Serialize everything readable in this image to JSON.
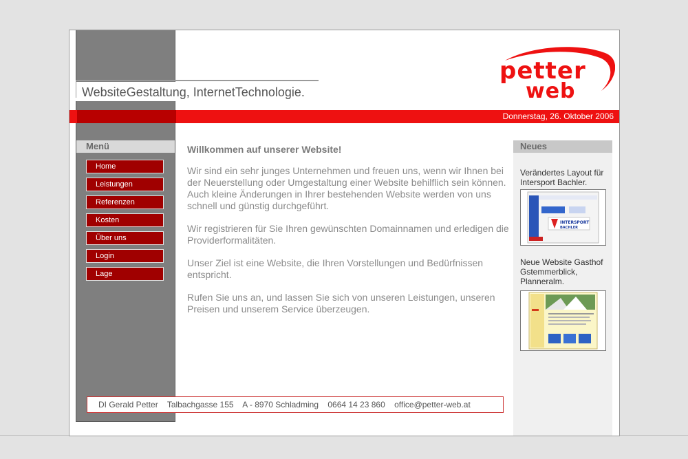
{
  "header": {
    "tagline": "WebsiteGestaltung, InternetTechnologie.",
    "logo_line1": "petter",
    "logo_line2": "web",
    "date": "Donnerstag, 26. Oktober 2006"
  },
  "menu": {
    "title": "Menü",
    "items": [
      "Home",
      "Leistungen",
      "Referenzen",
      "Kosten",
      "Über uns",
      "Login",
      "Lage"
    ]
  },
  "content": {
    "heading": "Willkommen auf unserer Website!",
    "paragraphs": [
      "Wir sind ein sehr junges Unternehmen und freuen uns, wenn wir Ihnen bei der Neuerstellung oder Umgestaltung einer Website behilflich sein können. Auch kleine Änderungen in Ihrer bestehenden Website werden von uns schnell und günstig durchgeführt.",
      "Wir registrieren für Sie Ihren gewünschten Domainnamen und erledigen die Providerformalitäten.",
      "Unser Ziel ist eine Website, die Ihren Vorstellungen und Bedürfnissen entspricht.",
      "Rufen Sie uns an, und lassen Sie sich von unseren Leistungen, unseren Preisen und unserem Service überzeugen."
    ]
  },
  "news": {
    "title": "Neues",
    "items": [
      {
        "text": "Verändertes Layout für Intersport Bachler.",
        "thumb_brand": "INTERSPORT",
        "thumb_sub": "BACHLER"
      },
      {
        "text": "Neue Website Gasthof Gstemmerblick, Planneralm."
      }
    ]
  },
  "footer": {
    "name": "DI Gerald Petter",
    "street": "Talbachgasse 155",
    "city": "A - 8970 Schladming",
    "phone": "0664 14 23 860",
    "email": "office@petter-web.at"
  },
  "colors": {
    "accent_red": "#ee1111",
    "menu_red": "#a00000",
    "sidebar_gray": "#7f7f7f"
  }
}
